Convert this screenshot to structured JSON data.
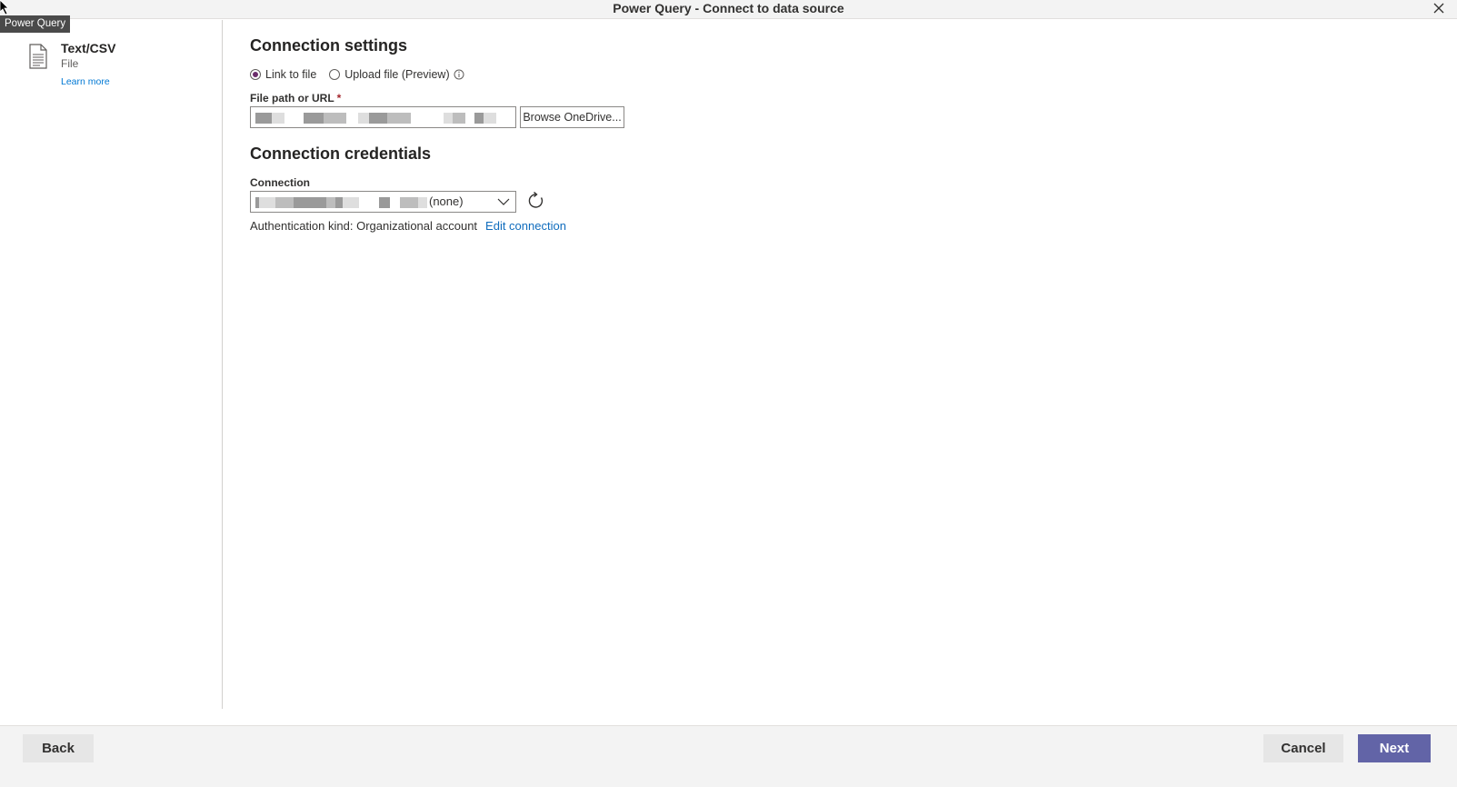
{
  "window": {
    "title": "Power Query - Connect to data source",
    "tooltip": "Power Query",
    "close_icon": "close-icon"
  },
  "sidebar": {
    "icon": "document-icon",
    "source_name": "Text/CSV",
    "source_type": "File",
    "learn_more": "Learn more"
  },
  "connection_settings": {
    "heading": "Connection settings",
    "radio_options": [
      {
        "label": "Link to file",
        "selected": true
      },
      {
        "label": "Upload file (Preview)",
        "selected": false
      }
    ],
    "info_icon": "info-icon",
    "file_path_label": "File path or URL",
    "required_marker": "*",
    "file_path_value": "",
    "browse_button": "Browse OneDrive..."
  },
  "connection_credentials": {
    "heading": "Connection credentials",
    "connection_label": "Connection",
    "connection_value_suffix": "(none)",
    "refresh_icon": "refresh-icon",
    "auth_text": "Authentication kind: Organizational account",
    "edit_link": "Edit connection"
  },
  "footer": {
    "back": "Back",
    "cancel": "Cancel",
    "next": "Next"
  },
  "colors": {
    "accent": "#6264a7",
    "link": "#0f6cbd",
    "radio_selected": "#6b2d6b",
    "required": "#a4262c"
  }
}
